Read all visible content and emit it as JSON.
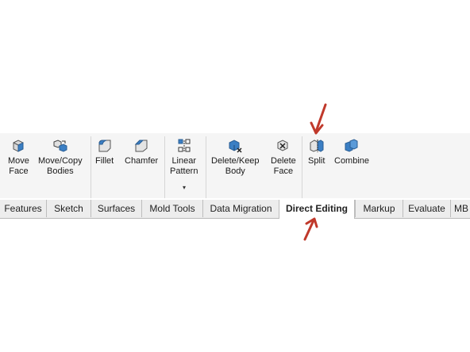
{
  "ribbon": {
    "buttons": [
      {
        "label1": "Move",
        "label2": "Face",
        "icon": "move-face-icon"
      },
      {
        "label1": "Move/Copy",
        "label2": "Bodies",
        "icon": "move-copy-bodies-icon"
      },
      {
        "label1": "Fillet",
        "label2": "",
        "icon": "fillet-icon"
      },
      {
        "label1": "Chamfer",
        "label2": "",
        "icon": "chamfer-icon"
      },
      {
        "label1": "Linear",
        "label2": "Pattern",
        "icon": "linear-pattern-icon"
      },
      {
        "label1": "Delete/Keep",
        "label2": "Body",
        "icon": "delete-keep-body-icon"
      },
      {
        "label1": "Delete",
        "label2": "Face",
        "icon": "delete-face-icon"
      },
      {
        "label1": "Split",
        "label2": "",
        "icon": "split-icon"
      },
      {
        "label1": "Combine",
        "label2": "",
        "icon": "combine-icon"
      }
    ],
    "linear_pattern_caret": "▾"
  },
  "tabs": [
    {
      "label": "Features"
    },
    {
      "label": "Sketch"
    },
    {
      "label": "Surfaces"
    },
    {
      "label": "Mold Tools"
    },
    {
      "label": "Data Migration"
    },
    {
      "label": "Direct Editing",
      "active": true
    },
    {
      "label": "Markup"
    },
    {
      "label": "Evaluate"
    },
    {
      "label": "MB"
    }
  ],
  "colors": {
    "annotation_arrow": "#c0392b",
    "icon_blue": "#3b7fc4",
    "icon_gray": "#8a8a8a"
  }
}
